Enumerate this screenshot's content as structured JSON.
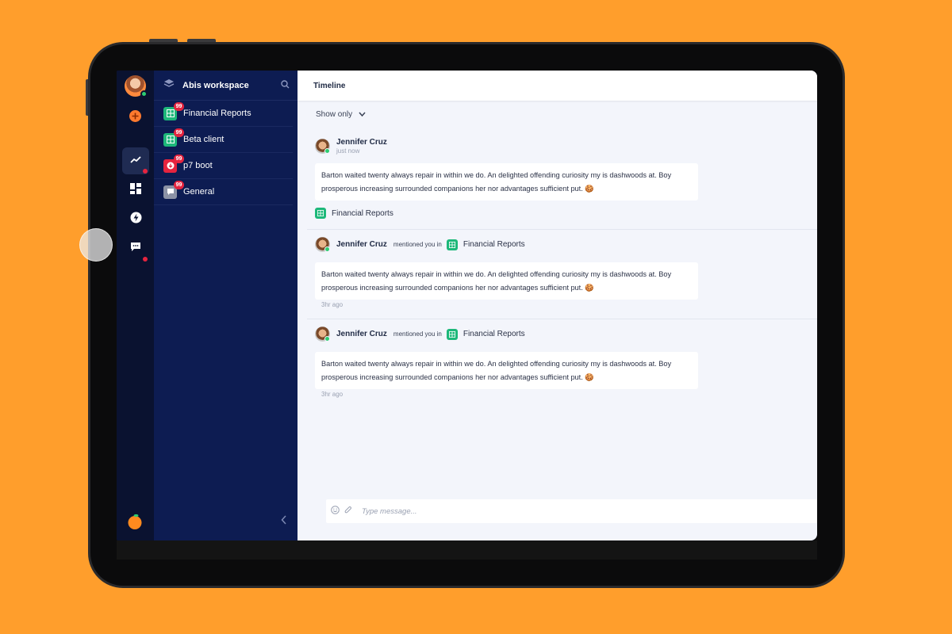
{
  "colors": {
    "background": "#FF9E2C",
    "sidebar": "#0d1c52",
    "rail": "#0a1230",
    "badge": "#e5243f",
    "online": "#2ecc71",
    "accent_green": "#1db87a"
  },
  "rail": {
    "items": [
      {
        "icon": "trending-up-icon",
        "active": true,
        "dot": true
      },
      {
        "icon": "dashboard-icon",
        "active": false,
        "dot": false
      },
      {
        "icon": "lightning-icon",
        "active": false,
        "dot": false
      },
      {
        "icon": "chat-icon",
        "active": false,
        "dot": true
      }
    ]
  },
  "sidebar": {
    "workspace": "Abis workspace",
    "channels": [
      {
        "label": "Financial Reports",
        "badge": "99",
        "icon": "table-icon",
        "color": "#1db87a"
      },
      {
        "label": "Beta client",
        "badge": "99",
        "icon": "table-icon",
        "color": "#1db87a"
      },
      {
        "label": "p7 boot",
        "badge": "99",
        "icon": "download-icon",
        "color": "#e5243f"
      },
      {
        "label": "General",
        "badge": "99",
        "icon": "message-icon",
        "color": "#8c93a6"
      }
    ]
  },
  "main": {
    "title": "Timeline",
    "filter": "Show only",
    "messages": [
      {
        "author": "Jennifer Cruz",
        "time": "just now",
        "text": "Barton waited twenty always repair in within we do. An delighted offending curiosity my is dashwoods at. Boy prosperous increasing surrounded companions her nor advantages sufficient put. 🍪",
        "channel_footer": "Financial Reports"
      },
      {
        "author": "Jennifer Cruz",
        "mention": "mentioned you in",
        "channel": "Financial Reports",
        "text": "Barton waited twenty always repair in within we do. An delighted offending curiosity my is dashwoods at. Boy prosperous increasing surrounded companions her nor advantages sufficient put. 🍪",
        "time": "3hr ago"
      },
      {
        "author": "Jennifer Cruz",
        "mention": "mentioned you in",
        "channel": "Financial Reports",
        "text": "Barton waited twenty always repair in within we do. An delighted offending curiosity my is dashwoods at. Boy prosperous increasing surrounded companions her nor advantages sufficient put. 🍪",
        "time": "3hr ago"
      }
    ],
    "input_placeholder": "Type message..."
  }
}
